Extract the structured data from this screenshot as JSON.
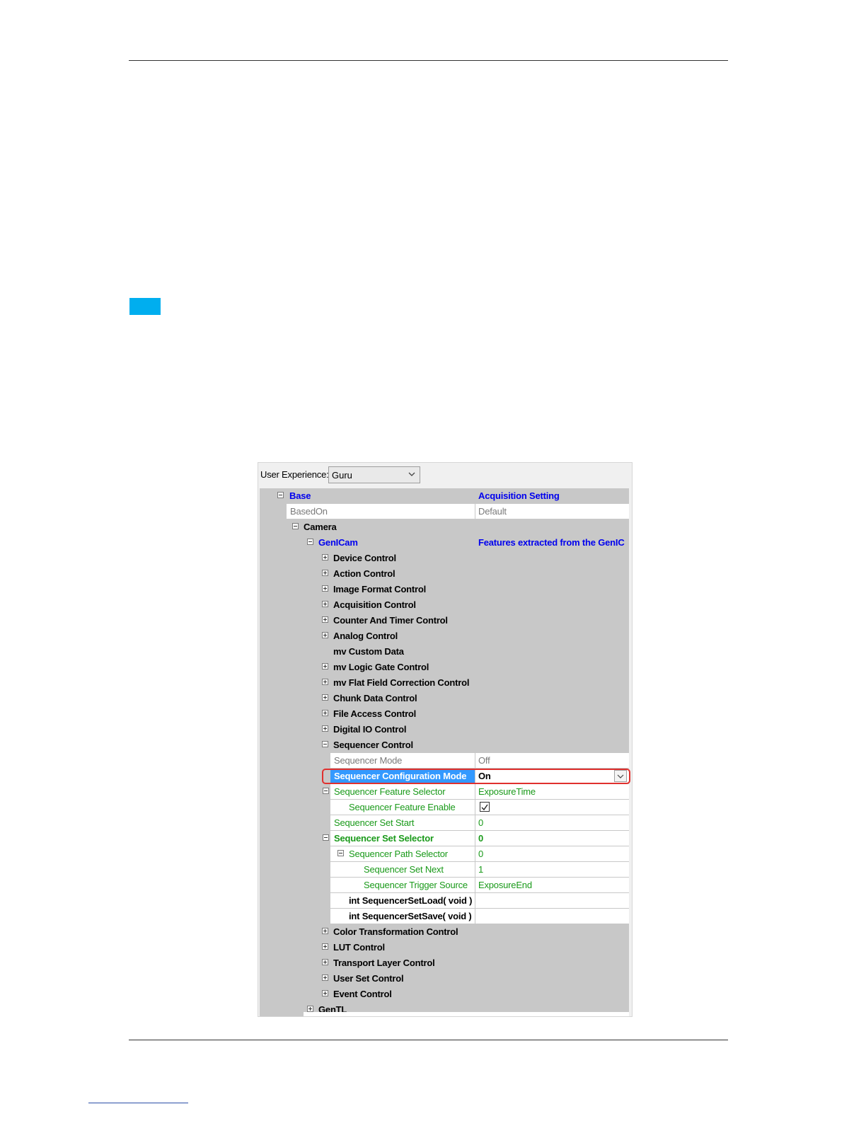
{
  "user_experience": {
    "label": "User Experience:",
    "value": "Guru"
  },
  "tree": {
    "base": {
      "name": "Base",
      "value": "Acquisition Setting"
    },
    "based_on": {
      "name": "BasedOn",
      "value": "Default"
    },
    "camera": {
      "name": "Camera"
    },
    "genicam": {
      "name": "GenICam",
      "value": "Features extracted from the GenIC"
    },
    "categories": [
      {
        "name": "Device Control"
      },
      {
        "name": "Action Control"
      },
      {
        "name": "Image Format Control"
      },
      {
        "name": "Acquisition Control"
      },
      {
        "name": "Counter And Timer Control"
      },
      {
        "name": "Analog Control"
      },
      {
        "name": "mv Custom Data"
      },
      {
        "name": "mv Logic Gate Control"
      },
      {
        "name": "mv Flat Field Correction Control"
      },
      {
        "name": "Chunk Data Control"
      },
      {
        "name": "File Access Control"
      },
      {
        "name": "Digital IO Control"
      },
      {
        "name": "Sequencer Control"
      }
    ],
    "sequencer": {
      "mode": {
        "name": "Sequencer Mode",
        "value": "Off"
      },
      "config_mode": {
        "name": "Sequencer Configuration Mode",
        "value": "On"
      },
      "feature_selector": {
        "name": "Sequencer Feature Selector",
        "value": "ExposureTime"
      },
      "feature_enable": {
        "name": "Sequencer Feature Enable",
        "checked": true
      },
      "set_start": {
        "name": "Sequencer Set Start",
        "value": "0"
      },
      "set_selector": {
        "name": "Sequencer Set Selector",
        "value": "0"
      },
      "path_selector": {
        "name": "Sequencer Path Selector",
        "value": "0"
      },
      "set_next": {
        "name": "Sequencer Set Next",
        "value": "1"
      },
      "trigger_source": {
        "name": "Sequencer Trigger Source",
        "value": "ExposureEnd"
      },
      "set_load": {
        "name": "int SequencerSetLoad( void )"
      },
      "set_save": {
        "name": "int SequencerSetSave( void )"
      }
    },
    "after_categories": [
      {
        "name": "Color Transformation Control"
      },
      {
        "name": "LUT Control"
      },
      {
        "name": "Transport Layer Control"
      },
      {
        "name": "User Set Control"
      },
      {
        "name": "Event Control"
      }
    ],
    "gentl": {
      "name": "GenTL"
    }
  },
  "colors": {
    "accent": "#00aeef",
    "selection": "#3399ff",
    "highlight_border": "#e0302e",
    "feature_green": "#1a9a1a",
    "heading_blue": "#0000ee"
  }
}
